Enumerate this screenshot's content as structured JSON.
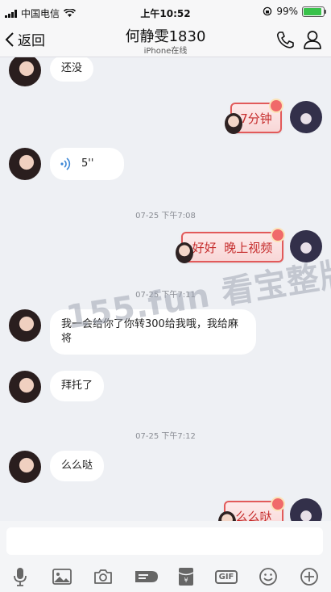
{
  "status_bar": {
    "carrier": "中国电信",
    "time": "上午10:52",
    "battery": "99%",
    "battery_level": 0.99
  },
  "nav": {
    "back_label": "返回",
    "title": "何静雯1830",
    "subtitle": "iPhone在线"
  },
  "messages": [
    {
      "from": "her",
      "type": "text",
      "text": "还没"
    },
    {
      "from": "me",
      "type": "text",
      "text": "7分钟"
    },
    {
      "from": "her",
      "type": "voice",
      "duration": "5''"
    },
    {
      "type": "timestamp",
      "text": "07-25 下午7:08"
    },
    {
      "from": "me",
      "type": "text",
      "text": "好好  晚上视频"
    },
    {
      "type": "timestamp",
      "text": "07-25 下午7:11"
    },
    {
      "from": "her",
      "type": "text",
      "text": "我一会给你了你转300给我哦，我给麻将"
    },
    {
      "from": "her",
      "type": "text",
      "text": "拜托了"
    },
    {
      "type": "timestamp",
      "text": "07-25 下午7:12"
    },
    {
      "from": "her",
      "type": "text",
      "text": "么么哒"
    },
    {
      "from": "me",
      "type": "text",
      "text": "么么哒"
    }
  ],
  "watermark": "155.fun 看宝整版",
  "input": {
    "placeholder": ""
  },
  "toolbar": {
    "icons": [
      "microphone-icon",
      "image-icon",
      "camera-icon",
      "red-packet-icon",
      "wallet-icon",
      "gif-icon",
      "emoji-icon",
      "plus-icon"
    ],
    "gif_label": "GIF"
  },
  "colors": {
    "background": "#eef0f4",
    "bubble_her": "#ffffff",
    "bubble_me_border": "#e25a5a",
    "bubble_me_text": "#c62d2d",
    "battery_fill": "#38c24a"
  }
}
